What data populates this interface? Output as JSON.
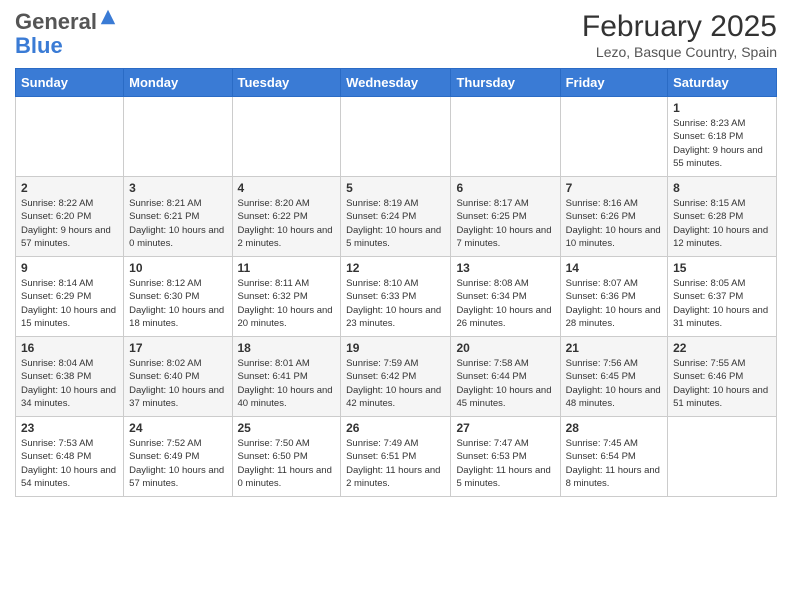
{
  "logo": {
    "general": "General",
    "blue": "Blue"
  },
  "header": {
    "title": "February 2025",
    "subtitle": "Lezo, Basque Country, Spain"
  },
  "weekdays": [
    "Sunday",
    "Monday",
    "Tuesday",
    "Wednesday",
    "Thursday",
    "Friday",
    "Saturday"
  ],
  "weeks": [
    [
      {
        "day": "",
        "info": ""
      },
      {
        "day": "",
        "info": ""
      },
      {
        "day": "",
        "info": ""
      },
      {
        "day": "",
        "info": ""
      },
      {
        "day": "",
        "info": ""
      },
      {
        "day": "",
        "info": ""
      },
      {
        "day": "1",
        "info": "Sunrise: 8:23 AM\nSunset: 6:18 PM\nDaylight: 9 hours and 55 minutes."
      }
    ],
    [
      {
        "day": "2",
        "info": "Sunrise: 8:22 AM\nSunset: 6:20 PM\nDaylight: 9 hours and 57 minutes."
      },
      {
        "day": "3",
        "info": "Sunrise: 8:21 AM\nSunset: 6:21 PM\nDaylight: 10 hours and 0 minutes."
      },
      {
        "day": "4",
        "info": "Sunrise: 8:20 AM\nSunset: 6:22 PM\nDaylight: 10 hours and 2 minutes."
      },
      {
        "day": "5",
        "info": "Sunrise: 8:19 AM\nSunset: 6:24 PM\nDaylight: 10 hours and 5 minutes."
      },
      {
        "day": "6",
        "info": "Sunrise: 8:17 AM\nSunset: 6:25 PM\nDaylight: 10 hours and 7 minutes."
      },
      {
        "day": "7",
        "info": "Sunrise: 8:16 AM\nSunset: 6:26 PM\nDaylight: 10 hours and 10 minutes."
      },
      {
        "day": "8",
        "info": "Sunrise: 8:15 AM\nSunset: 6:28 PM\nDaylight: 10 hours and 12 minutes."
      }
    ],
    [
      {
        "day": "9",
        "info": "Sunrise: 8:14 AM\nSunset: 6:29 PM\nDaylight: 10 hours and 15 minutes."
      },
      {
        "day": "10",
        "info": "Sunrise: 8:12 AM\nSunset: 6:30 PM\nDaylight: 10 hours and 18 minutes."
      },
      {
        "day": "11",
        "info": "Sunrise: 8:11 AM\nSunset: 6:32 PM\nDaylight: 10 hours and 20 minutes."
      },
      {
        "day": "12",
        "info": "Sunrise: 8:10 AM\nSunset: 6:33 PM\nDaylight: 10 hours and 23 minutes."
      },
      {
        "day": "13",
        "info": "Sunrise: 8:08 AM\nSunset: 6:34 PM\nDaylight: 10 hours and 26 minutes."
      },
      {
        "day": "14",
        "info": "Sunrise: 8:07 AM\nSunset: 6:36 PM\nDaylight: 10 hours and 28 minutes."
      },
      {
        "day": "15",
        "info": "Sunrise: 8:05 AM\nSunset: 6:37 PM\nDaylight: 10 hours and 31 minutes."
      }
    ],
    [
      {
        "day": "16",
        "info": "Sunrise: 8:04 AM\nSunset: 6:38 PM\nDaylight: 10 hours and 34 minutes."
      },
      {
        "day": "17",
        "info": "Sunrise: 8:02 AM\nSunset: 6:40 PM\nDaylight: 10 hours and 37 minutes."
      },
      {
        "day": "18",
        "info": "Sunrise: 8:01 AM\nSunset: 6:41 PM\nDaylight: 10 hours and 40 minutes."
      },
      {
        "day": "19",
        "info": "Sunrise: 7:59 AM\nSunset: 6:42 PM\nDaylight: 10 hours and 42 minutes."
      },
      {
        "day": "20",
        "info": "Sunrise: 7:58 AM\nSunset: 6:44 PM\nDaylight: 10 hours and 45 minutes."
      },
      {
        "day": "21",
        "info": "Sunrise: 7:56 AM\nSunset: 6:45 PM\nDaylight: 10 hours and 48 minutes."
      },
      {
        "day": "22",
        "info": "Sunrise: 7:55 AM\nSunset: 6:46 PM\nDaylight: 10 hours and 51 minutes."
      }
    ],
    [
      {
        "day": "23",
        "info": "Sunrise: 7:53 AM\nSunset: 6:48 PM\nDaylight: 10 hours and 54 minutes."
      },
      {
        "day": "24",
        "info": "Sunrise: 7:52 AM\nSunset: 6:49 PM\nDaylight: 10 hours and 57 minutes."
      },
      {
        "day": "25",
        "info": "Sunrise: 7:50 AM\nSunset: 6:50 PM\nDaylight: 11 hours and 0 minutes."
      },
      {
        "day": "26",
        "info": "Sunrise: 7:49 AM\nSunset: 6:51 PM\nDaylight: 11 hours and 2 minutes."
      },
      {
        "day": "27",
        "info": "Sunrise: 7:47 AM\nSunset: 6:53 PM\nDaylight: 11 hours and 5 minutes."
      },
      {
        "day": "28",
        "info": "Sunrise: 7:45 AM\nSunset: 6:54 PM\nDaylight: 11 hours and 8 minutes."
      },
      {
        "day": "",
        "info": ""
      }
    ]
  ]
}
